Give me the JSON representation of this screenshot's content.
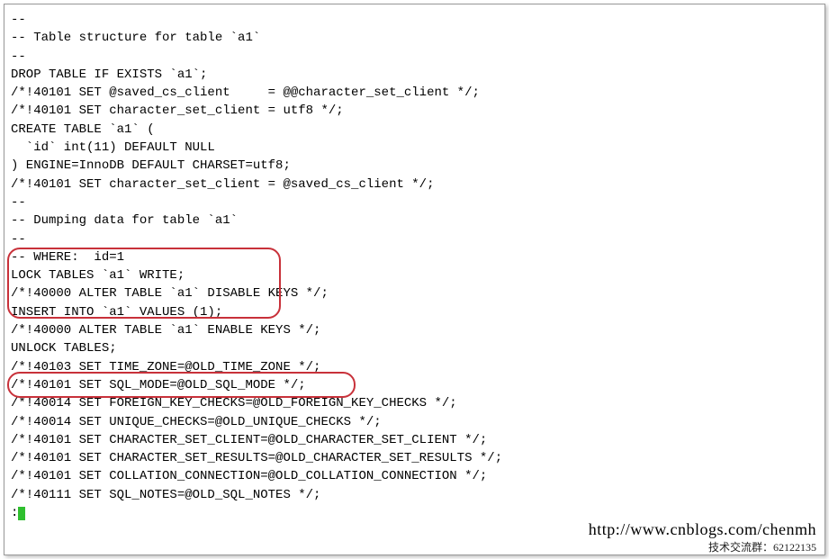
{
  "lines": {
    "l0": "--",
    "l1": "-- Table structure for table `a1`",
    "l2": "--",
    "l3": "",
    "l4": "DROP TABLE IF EXISTS `a1`;",
    "l5": "/*!40101 SET @saved_cs_client     = @@character_set_client */;",
    "l6": "/*!40101 SET character_set_client = utf8 */;",
    "l7": "CREATE TABLE `a1` (",
    "l8": "  `id` int(11) DEFAULT NULL",
    "l9": ") ENGINE=InnoDB DEFAULT CHARSET=utf8;",
    "l10": "/*!40101 SET character_set_client = @saved_cs_client */;",
    "l11": "",
    "l12": "--",
    "l13": "-- Dumping data for table `a1`",
    "l14": "--",
    "l15": "-- WHERE:  id=1",
    "l16": "",
    "l17": "LOCK TABLES `a1` WRITE;",
    "l18": "/*!40000 ALTER TABLE `a1` DISABLE KEYS */;",
    "l19": "INSERT INTO `a1` VALUES (1);",
    "l20": "/*!40000 ALTER TABLE `a1` ENABLE KEYS */;",
    "l21": "UNLOCK TABLES;",
    "l22": "/*!40103 SET TIME_ZONE=@OLD_TIME_ZONE */;",
    "l23": "",
    "l24": "/*!40101 SET SQL_MODE=@OLD_SQL_MODE */;",
    "l25": "/*!40014 SET FOREIGN_KEY_CHECKS=@OLD_FOREIGN_KEY_CHECKS */;",
    "l26": "/*!40014 SET UNIQUE_CHECKS=@OLD_UNIQUE_CHECKS */;",
    "l27": "/*!40101 SET CHARACTER_SET_CLIENT=@OLD_CHARACTER_SET_CLIENT */;",
    "l28": "/*!40101 SET CHARACTER_SET_RESULTS=@OLD_CHARACTER_SET_RESULTS */;",
    "l29": "/*!40101 SET COLLATION_CONNECTION=@OLD_COLLATION_CONNECTION */;",
    "l30": "/*!40111 SET SQL_NOTES=@OLD_SQL_NOTES */;"
  },
  "prompt": ":",
  "watermark_url": "http://www.cnblogs.com/chenmh",
  "watermark_group": "技术交流群：62122135"
}
